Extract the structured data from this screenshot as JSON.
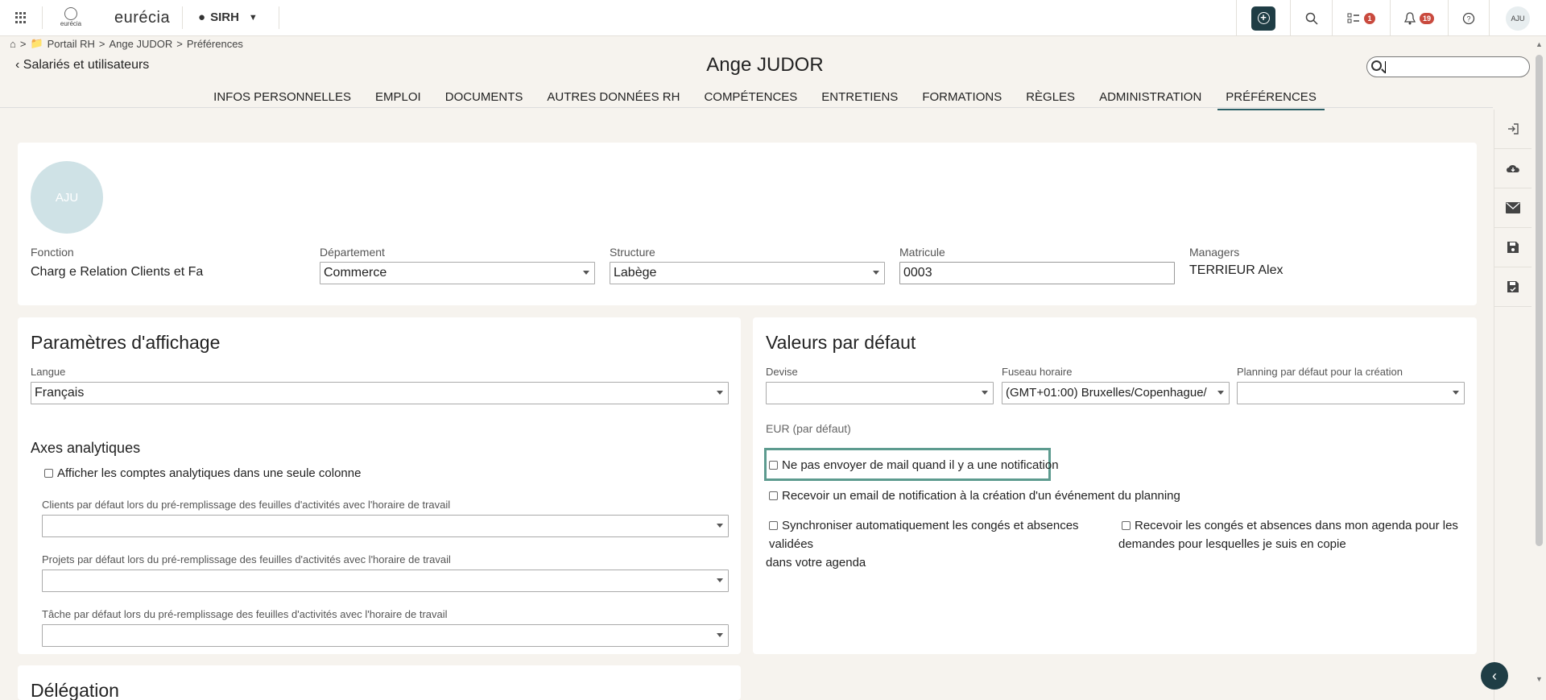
{
  "topbar": {
    "logo_text": "eurécia",
    "brand": "eurécia",
    "module": "SIRH",
    "tasks_badge": "1",
    "notif_badge": "19",
    "user_initials": "AJU"
  },
  "breadcrumb": {
    "portal": "Portail RH",
    "employee": "Ange JUDOR",
    "page": "Préférences",
    "sep": ">"
  },
  "header": {
    "back_label": "Salariés et utilisateurs",
    "title": "Ange JUDOR",
    "search_value": ""
  },
  "tabs": [
    {
      "label": "INFOS PERSONNELLES"
    },
    {
      "label": "EMPLOI"
    },
    {
      "label": "DOCUMENTS"
    },
    {
      "label": "AUTRES DONNÉES RH"
    },
    {
      "label": "COMPÉTENCES"
    },
    {
      "label": "ENTRETIENS"
    },
    {
      "label": "FORMATIONS"
    },
    {
      "label": "RÈGLES"
    },
    {
      "label": "ADMINISTRATION"
    },
    {
      "label": "PRÉFÉRENCES",
      "active": true
    }
  ],
  "profile": {
    "initials": "AJU",
    "fonction_label": "Fonction",
    "fonction_value": "Charg e Relation Clients et Fa",
    "departement_label": "Département",
    "departement_value": "Commerce",
    "structure_label": "Structure",
    "structure_value": "Labège",
    "matricule_label": "Matricule",
    "matricule_value": "0003",
    "managers_label": "Managers",
    "managers_value": "TERRIEUR Alex"
  },
  "display": {
    "title": "Paramètres d'affichage",
    "langue_label": "Langue",
    "langue_value": "Français",
    "axes_title": "Axes analytiques",
    "axes_checkbox": "Afficher les comptes analytiques dans une seule colonne",
    "clients_label": "Clients par défaut lors du pré-remplissage des feuilles d'activités avec l'horaire de travail",
    "projets_label": "Projets par défaut lors du pré-remplissage des feuilles d'activités avec l'horaire de travail",
    "tache_label": "Tâche par défaut lors du pré-remplissage des feuilles d'activités avec l'horaire de travail"
  },
  "defaults": {
    "title": "Valeurs par défaut",
    "devise_label": "Devise",
    "devise_value": "",
    "fuseau_label": "Fuseau horaire",
    "fuseau_value": "(GMT+01:00) Bruxelles/Copenhague/",
    "planning_label": "Planning par défaut pour la création",
    "planning_value": "",
    "eur_note": "EUR (par défaut)",
    "cb_no_mail": "Ne pas envoyer de mail quand il y a une notification",
    "cb_notif_planning": "Recevoir un email de notification à la création d'un événement du planning",
    "cb_sync_line1": "Synchroniser automatiquement les congés et absences validées",
    "cb_sync_line2": "dans votre agenda",
    "cb_copy_line1": "Recevoir les congés et absences dans mon agenda pour les",
    "cb_copy_line2": "demandes pour lesquelles je suis en copie"
  },
  "delegation": {
    "title_partial": "Délégation"
  },
  "rail_icons": [
    "logout-icon",
    "cloud-download-icon",
    "mail-icon",
    "save-icon",
    "save-as-icon"
  ]
}
